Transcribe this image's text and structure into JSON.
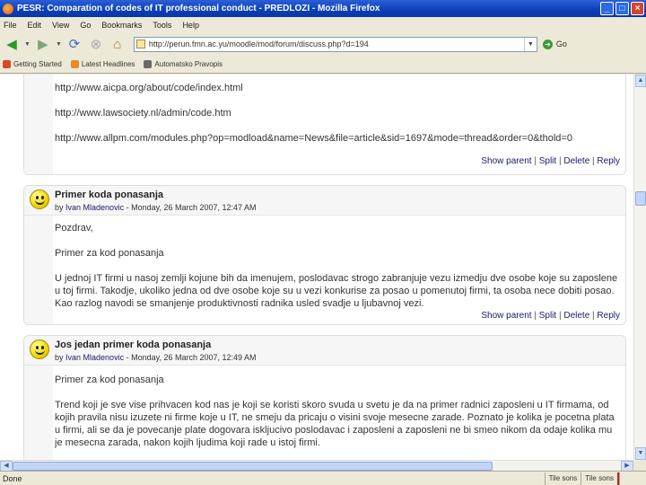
{
  "window": {
    "title": "PESR: Comparation of codes of IT professional conduct - PREDLOZI - Mozilla Firefox"
  },
  "menu": [
    "File",
    "Edit",
    "View",
    "Go",
    "Bookmarks",
    "Tools",
    "Help"
  ],
  "toolbar": {
    "url": "http://perun.fmn.ac.yu/moodle/mod/forum/discuss.php?d=194",
    "go_label": "Go"
  },
  "bookmarks": [
    {
      "label": "Getting Started",
      "icon": "getting-started-icon",
      "color": "#d94a2a"
    },
    {
      "label": "Latest Headlines",
      "icon": "rss-icon",
      "color": "#e88a2a"
    },
    {
      "label": "Automatsko Pravopis",
      "icon": "bookmark-icon",
      "color": "#6a6a6a"
    }
  ],
  "posts": [
    {
      "links": [
        "http://www.aicpa.org/about/code/index.html",
        "http://www.lawsociety.nl/admin/code.htm",
        "http://www.allpm.com/modules.php?op=modload&name=News&file=article&sid=1697&mode=thread&order=0&thold=0"
      ],
      "commands": [
        "Show parent",
        "Split",
        "Delete",
        "Reply"
      ]
    },
    {
      "subject": "Primer koda ponasanja",
      "by": "by",
      "author": "Ivan Mladenovic",
      "date": "- Monday, 26 March 2007, 12:47 AM",
      "paragraphs": [
        "Pozdrav,",
        "Primer za kod ponasanja",
        "U jednoj IT firmi u nasoj zemlji kojune bih da imenujem, poslodavac strogo zabranjuje vezu izmedju dve osobe koje su zaposlene u toj firmi. Takodje, ukoliko jedna od dve osobe koje su u vezi konkurise za posao u pomenutoj firmi, ta osoba nece dobiti posao. Kao razlog navodi se smanjenje produktivnosti radnika usled svadje u ljubavnoj vezi."
      ],
      "commands": [
        "Show parent",
        "Split",
        "Delete",
        "Reply"
      ]
    },
    {
      "subject": "Jos jedan primer koda ponasanja",
      "by": "by",
      "author": "Ivan Mladenovic",
      "date": "- Monday, 26 March 2007, 12:49 AM",
      "paragraphs": [
        "Primer za kod ponasanja",
        "Trend koji je sve vise prihvacen kod nas je koji se koristi skoro svuda u svetu je da na primer radnici zaposleni u IT firmama, od kojih pravila nisu izuzete ni firme koje u IT, ne smeju da pricaju o visini svoje mesecne zarade. Poznato je kolika je pocetna plata u firmi, ali se da je povecanje plate dogovara iskljucivo poslodavac i zaposleni a zaposleni ne bi smeo nikom da odaje kolika mu je mesecna zarada, nakon kojih ljudima koji rade u istoj firmi."
      ]
    }
  ],
  "status": {
    "text": "Done",
    "panel1": "Tile sons",
    "panel2": "Tile sons"
  }
}
